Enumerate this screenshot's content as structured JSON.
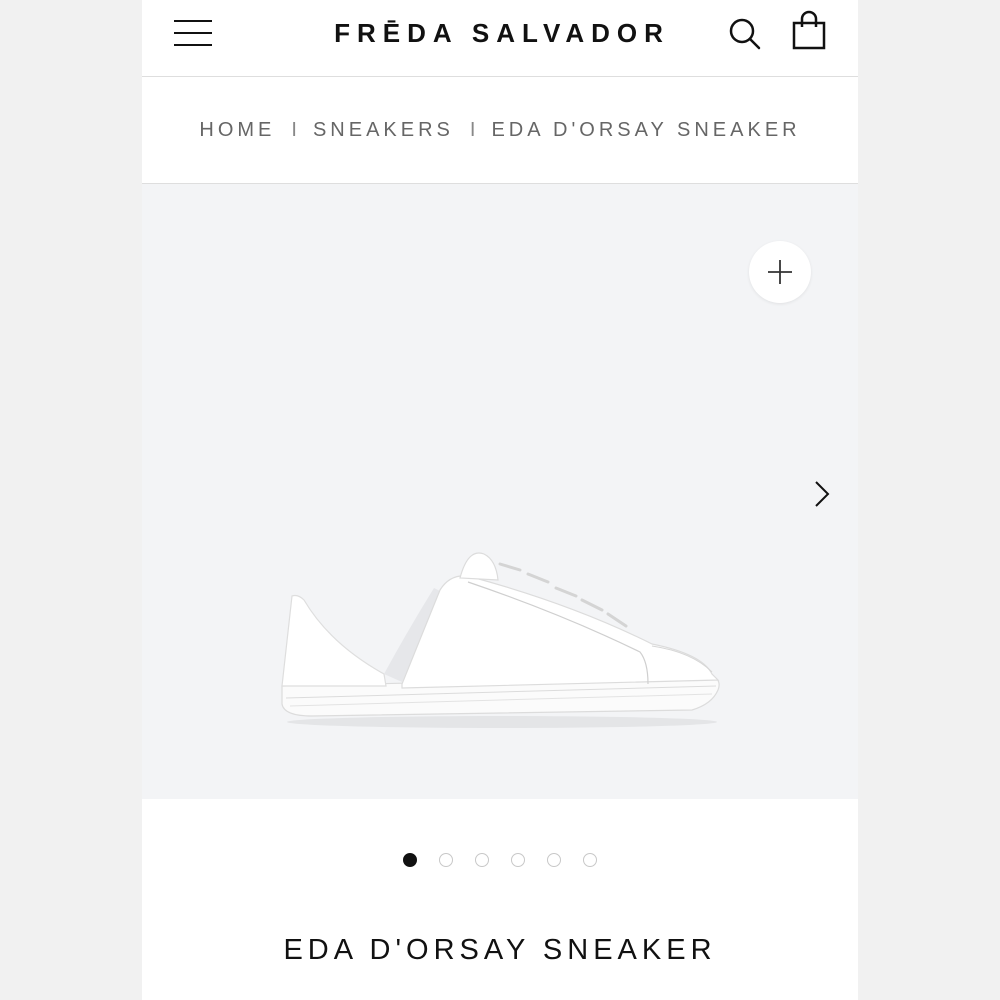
{
  "header": {
    "brand": "FRĒDA SALVADOR",
    "menu_icon": "hamburger-menu-icon",
    "search_icon": "search-icon",
    "bag_icon": "shopping-bag-icon"
  },
  "breadcrumb": {
    "items": [
      {
        "label": "HOME"
      },
      {
        "label": "SNEAKERS"
      },
      {
        "label": "EDA D'ORSAY SNEAKER"
      }
    ],
    "separator": "I"
  },
  "gallery": {
    "zoom_icon": "plus-icon",
    "next_icon": "chevron-right-icon",
    "image_count": 6,
    "active_index": 0
  },
  "product": {
    "title": "EDA D'ORSAY SNEAKER"
  },
  "colors": {
    "text": "#111111",
    "muted": "#666666",
    "gallery_bg": "#f3f4f6"
  }
}
